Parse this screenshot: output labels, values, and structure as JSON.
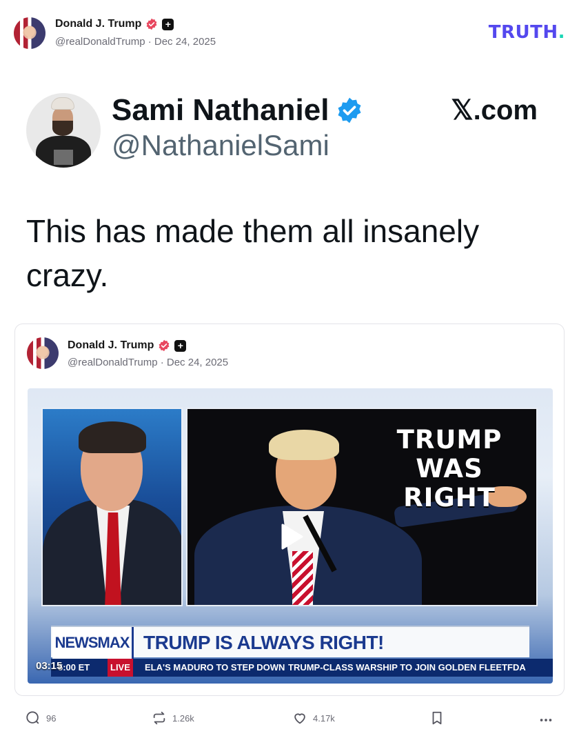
{
  "header": {
    "author_name": "Donald J. Trump",
    "author_handle": "@realDonaldTrump · Dec 24, 2025",
    "brand": "TRUTH",
    "brand_dot": ".",
    "brand_color": "#5448ee",
    "badge_color": "#e8475f"
  },
  "x_post": {
    "name": "Sami Nathaniel",
    "handle": "@NathanielSami",
    "source": "𝕏.com",
    "text": "This has made them all insanely crazy."
  },
  "quoted_post": {
    "author_name": "Donald J. Trump",
    "author_handle": "@realDonaldTrump · Dec 24, 2025",
    "video": {
      "overlay_text": [
        "TRUMP",
        "WAS",
        "RIGHT"
      ],
      "network": "NEWSMAX",
      "headline": "TRUMP IS ALWAYS RIGHT!",
      "ticker_time": "5:00 ET",
      "ticker_live": "LIVE",
      "ticker_1": "ELA'S MADURO TO STEP DOWN",
      "ticker_2": "TRUMP-CLASS WARSHIP TO JOIN GOLDEN FLEET",
      "ticker_3": "FDA",
      "duration": "03:15"
    }
  },
  "actions": {
    "replies": "96",
    "retruths": "1.26k",
    "likes": "4.17k"
  }
}
